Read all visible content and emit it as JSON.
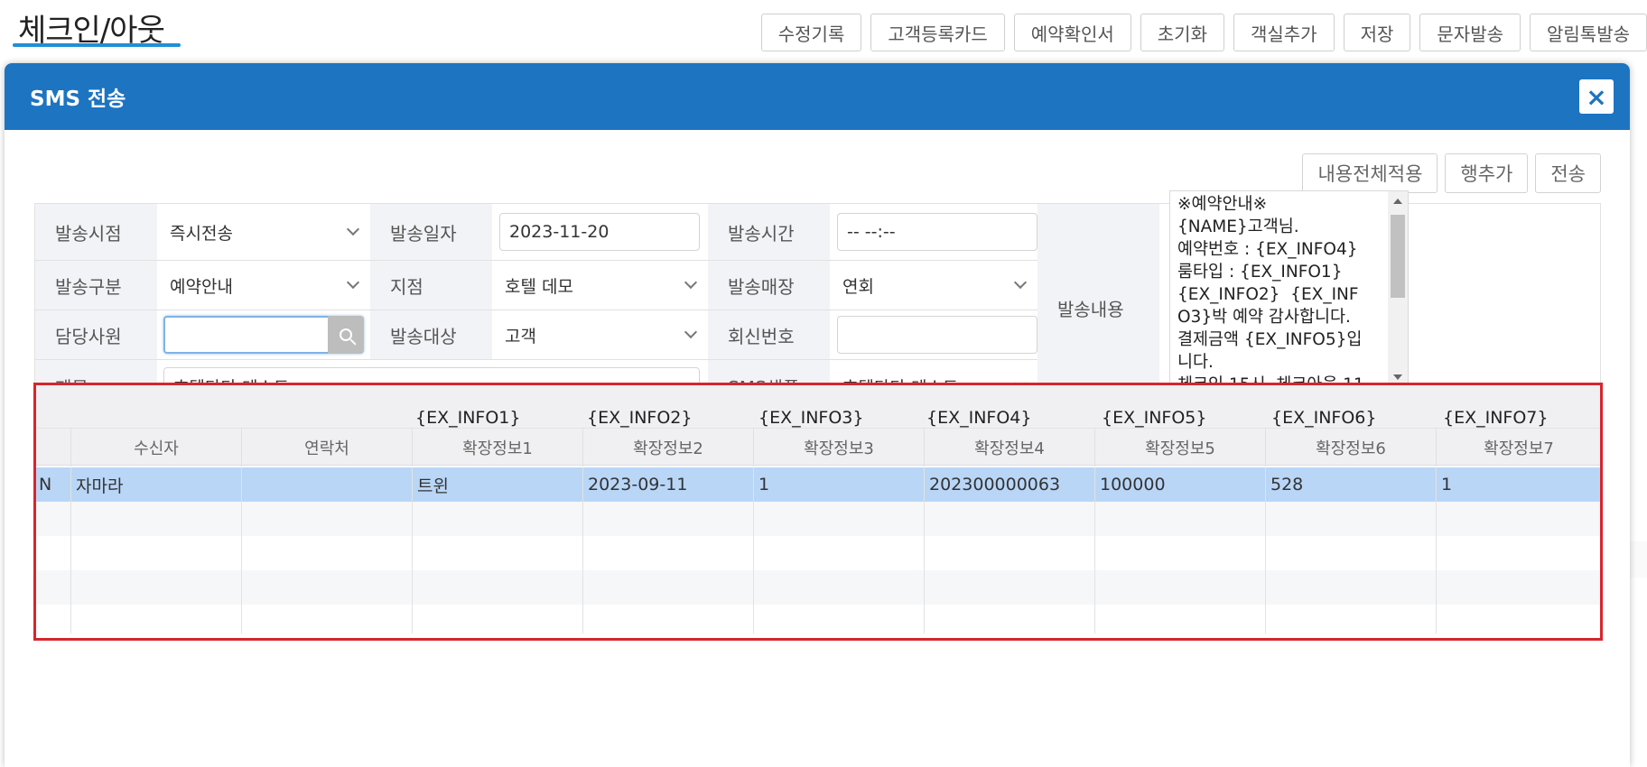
{
  "page": {
    "title": "체크인/아웃"
  },
  "toolbar": {
    "buttons": [
      "수정기록",
      "고객등록카드",
      "예약확인서",
      "초기화",
      "객실추가",
      "저장",
      "문자발송",
      "알림톡발송"
    ]
  },
  "modal": {
    "title": "SMS 전송",
    "close_label": "×",
    "actions": [
      "내용전체적용",
      "행추가",
      "전송"
    ],
    "form": {
      "send_time_point": {
        "label": "발송시점",
        "value": "즉시전송"
      },
      "send_date": {
        "label": "발송일자",
        "value": "2023-11-20"
      },
      "send_time": {
        "label": "발송시간",
        "value": "-- --:--"
      },
      "send_type": {
        "label": "발송구분",
        "value": "예약안내"
      },
      "branch": {
        "label": "지점",
        "value": "호텔 데모"
      },
      "send_store": {
        "label": "발송매장",
        "value": "연회"
      },
      "staff": {
        "label": "담당사원",
        "value": ""
      },
      "target": {
        "label": "발송대상",
        "value": "고객"
      },
      "reply_number": {
        "label": "회신번호",
        "value": ""
      },
      "subject": {
        "label": "제목",
        "value": "호텔다다 테스트"
      },
      "sms_sample": {
        "label": "SMS샘플",
        "value": "호텔다다 테스트"
      },
      "content": {
        "label": "발송내용",
        "value": "※예약안내※\n{NAME}고객님.\n예약번호 : {EX_INFO4}\n룸타입 : {EX_INFO1}\n{EX_INFO2}  {EX_INFO3}박 예약 감사합니다.\n결제금액 {EX_INFO5}입니다.\n체크인 15시, 체크아웃 11"
      }
    },
    "grid": {
      "ex_labels": [
        "{EX_INFO1}",
        "{EX_INFO2}",
        "{EX_INFO3}",
        "{EX_INFO4}",
        "{EX_INFO5}",
        "{EX_INFO6}",
        "{EX_INFO7}"
      ],
      "columns": [
        "수신자",
        "연락처",
        "확장정보1",
        "확장정보2",
        "확장정보3",
        "확장정보4",
        "확장정보5",
        "확장정보6",
        "확장정보7"
      ],
      "rows": [
        {
          "flag": "N",
          "cells": [
            "자마라",
            "",
            "트윈",
            "2023-09-11",
            "1",
            "202300000063",
            "100000",
            "528",
            "1"
          ]
        }
      ]
    }
  },
  "colors": {
    "header_blue": "#1d74c1",
    "selected_row": "#b9d6f7",
    "highlight_red": "#d6262d",
    "title_underline": "#1f8fd6"
  }
}
